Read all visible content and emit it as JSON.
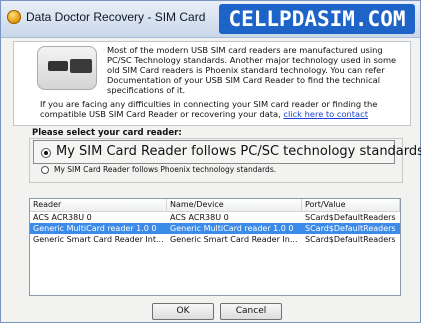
{
  "window": {
    "title": "Data Doctor Recovery - SIM Card",
    "brand": "CELLPDASIM.COM"
  },
  "info": {
    "paragraph1": "Most of the modern USB SIM card readers are manufactured using PC/SC Technology standards. Another major technology used in some old SIM Card readers is Phoenix standard technology. You can refer Documentation of your USB SIM Card Reader to find the technical specifications of it.",
    "paragraph2": "If you are facing any difficulties in connecting your SIM card reader or finding the compatible USB SIM Card Reader or recovering your data,",
    "link": "click here to contact"
  },
  "reader_select": {
    "group_label": "Please select your card reader:",
    "options": [
      {
        "label": "My SIM Card Reader follows PC/SC technology standards.",
        "selected": true
      },
      {
        "label": "My SIM Card Reader follows Phoenix technology standards.",
        "selected": false
      }
    ]
  },
  "readers_table": {
    "columns": [
      "Reader",
      "Name/Device",
      "Port/Value"
    ],
    "rows": [
      {
        "reader": "ACS ACR38U 0",
        "device": "ACS ACR38U 0",
        "port": "SCard$DefaultReaders",
        "selected": false
      },
      {
        "reader": "Generic MultiCard reader 1.0 0",
        "device": "Generic MultiCard reader 1.0 0",
        "port": "SCard$DefaultReaders",
        "selected": true
      },
      {
        "reader": "Generic Smart Card Reader Int...",
        "device": "Generic Smart Card Reader In...",
        "port": "SCard$DefaultReaders",
        "selected": false
      }
    ]
  },
  "buttons": {
    "ok": "OK",
    "cancel": "Cancel"
  },
  "colors": {
    "brand_bg": "#1d63c8",
    "selection": "#3d8be8",
    "link": "#1a3fd1"
  }
}
